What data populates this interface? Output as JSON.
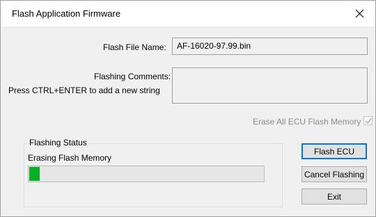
{
  "window": {
    "title": "Flash Application Firmware"
  },
  "form": {
    "file_label": "Flash File Name:",
    "file_value": "AF-16020-97.99.bin",
    "comments_label": "Flashing Comments:",
    "comments_hint": "Press CTRL+ENTER to add a new string",
    "comments_value": "",
    "erase_label": "Erase All ECU Flash Memory",
    "erase_checked": true
  },
  "status": {
    "group_title": "Flashing Status",
    "message": "Erasing Flash Memory",
    "progress_fraction": 0.045,
    "progress_color": "#06b025"
  },
  "buttons": {
    "flash": "Flash ECU",
    "cancel": "Cancel Flashing",
    "exit": "Exit"
  },
  "icons": {
    "close": "close-icon",
    "check": "check-icon"
  }
}
